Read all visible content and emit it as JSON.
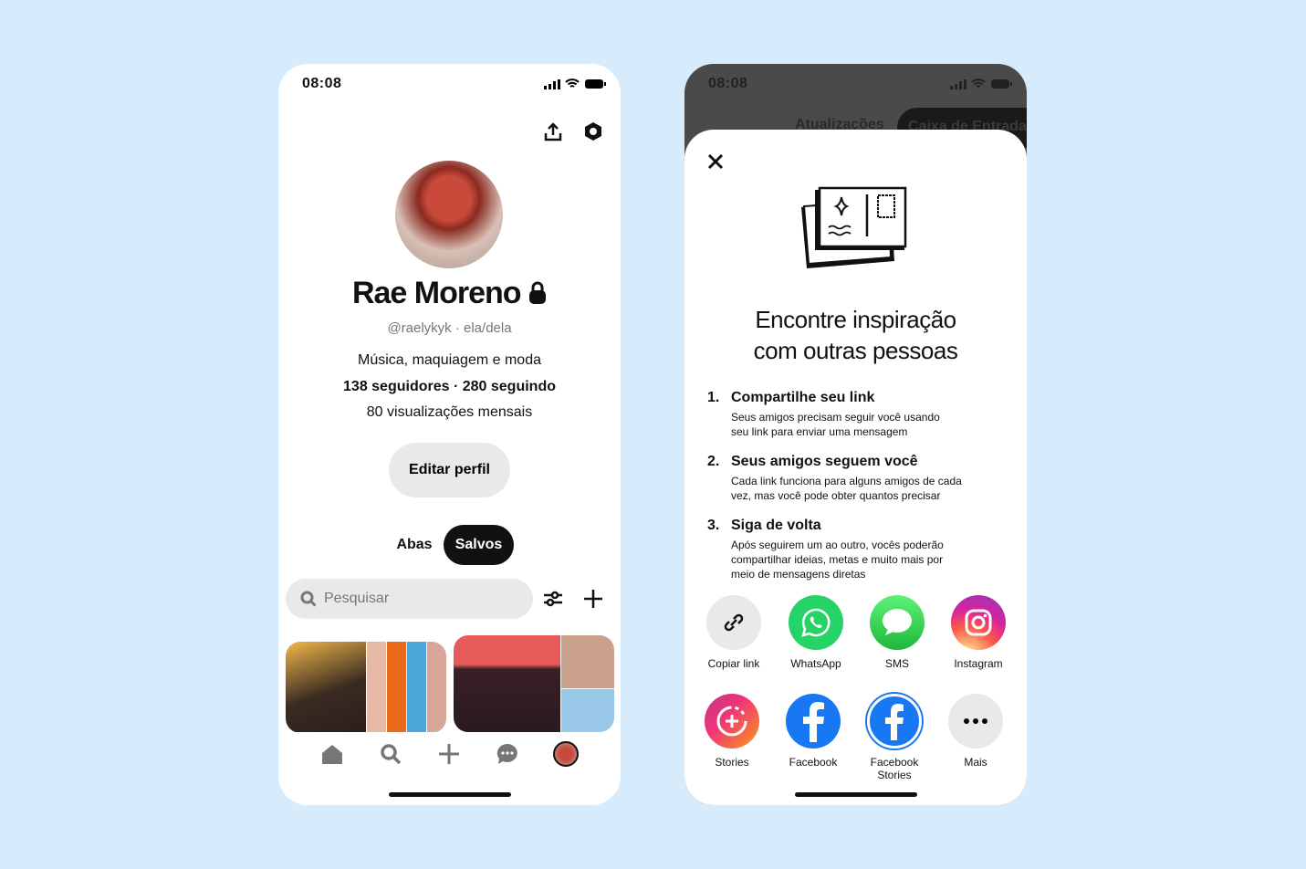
{
  "profile": {
    "status_time": "08:08",
    "name": "Rae Moreno",
    "handle": "@raelykyk · ela/dela",
    "bio": "Música, maquiagem e moda",
    "stats": "138 seguidores · 280 seguindo",
    "views": "80 visualizações mensais",
    "edit_button": "Editar perfil",
    "tabs": [
      {
        "label": "Abas",
        "active": false
      },
      {
        "label": "Salvos",
        "active": true
      }
    ],
    "search_placeholder": "Pesquisar",
    "icons": [
      "share-icon",
      "settings-icon",
      "lock-icon",
      "search-icon",
      "filter-icon",
      "plus-icon"
    ],
    "nav": [
      "home-icon",
      "search-icon",
      "plus-icon",
      "messages-icon",
      "profile-avatar"
    ]
  },
  "share": {
    "status_time": "08:08",
    "background_tabs": [
      "Atualizações",
      "Caixa de Entrada"
    ],
    "title_line1": "Encontre inspiração",
    "title_line2": "com outras pessoas",
    "steps": [
      {
        "num": "1.",
        "title": "Compartilhe seu link",
        "desc": "Seus amigos precisam seguir você usando seu link para enviar uma mensagem"
      },
      {
        "num": "2.",
        "title": "Seus amigos seguem você",
        "desc": "Cada link funciona para alguns amigos de cada vez, mas você pode obter quantos precisar"
      },
      {
        "num": "3.",
        "title": "Siga de volta",
        "desc": "Após seguirem um ao outro, vocês poderão compartilhar ideias, metas e muito mais por meio de mensagens diretas"
      }
    ],
    "options": [
      {
        "label": "Copiar link",
        "icon": "link-icon",
        "color": "#e9e9e9"
      },
      {
        "label": "WhatsApp",
        "icon": "whatsapp-icon",
        "color": "#25d366"
      },
      {
        "label": "SMS",
        "icon": "sms-icon",
        "color": "#2fc84a"
      },
      {
        "label": "Instagram",
        "icon": "instagram-icon",
        "color": "#e1306c"
      },
      {
        "label": "Stories",
        "icon": "stories-icon",
        "color": "#f0357a"
      },
      {
        "label": "Facebook",
        "icon": "facebook-icon",
        "color": "#1877f2"
      },
      {
        "label": "Facebook Stories",
        "icon": "facebook-stories-icon",
        "color": "#1877f2"
      },
      {
        "label": "Mais",
        "icon": "more-icon",
        "color": "#e9e9e9"
      }
    ]
  }
}
